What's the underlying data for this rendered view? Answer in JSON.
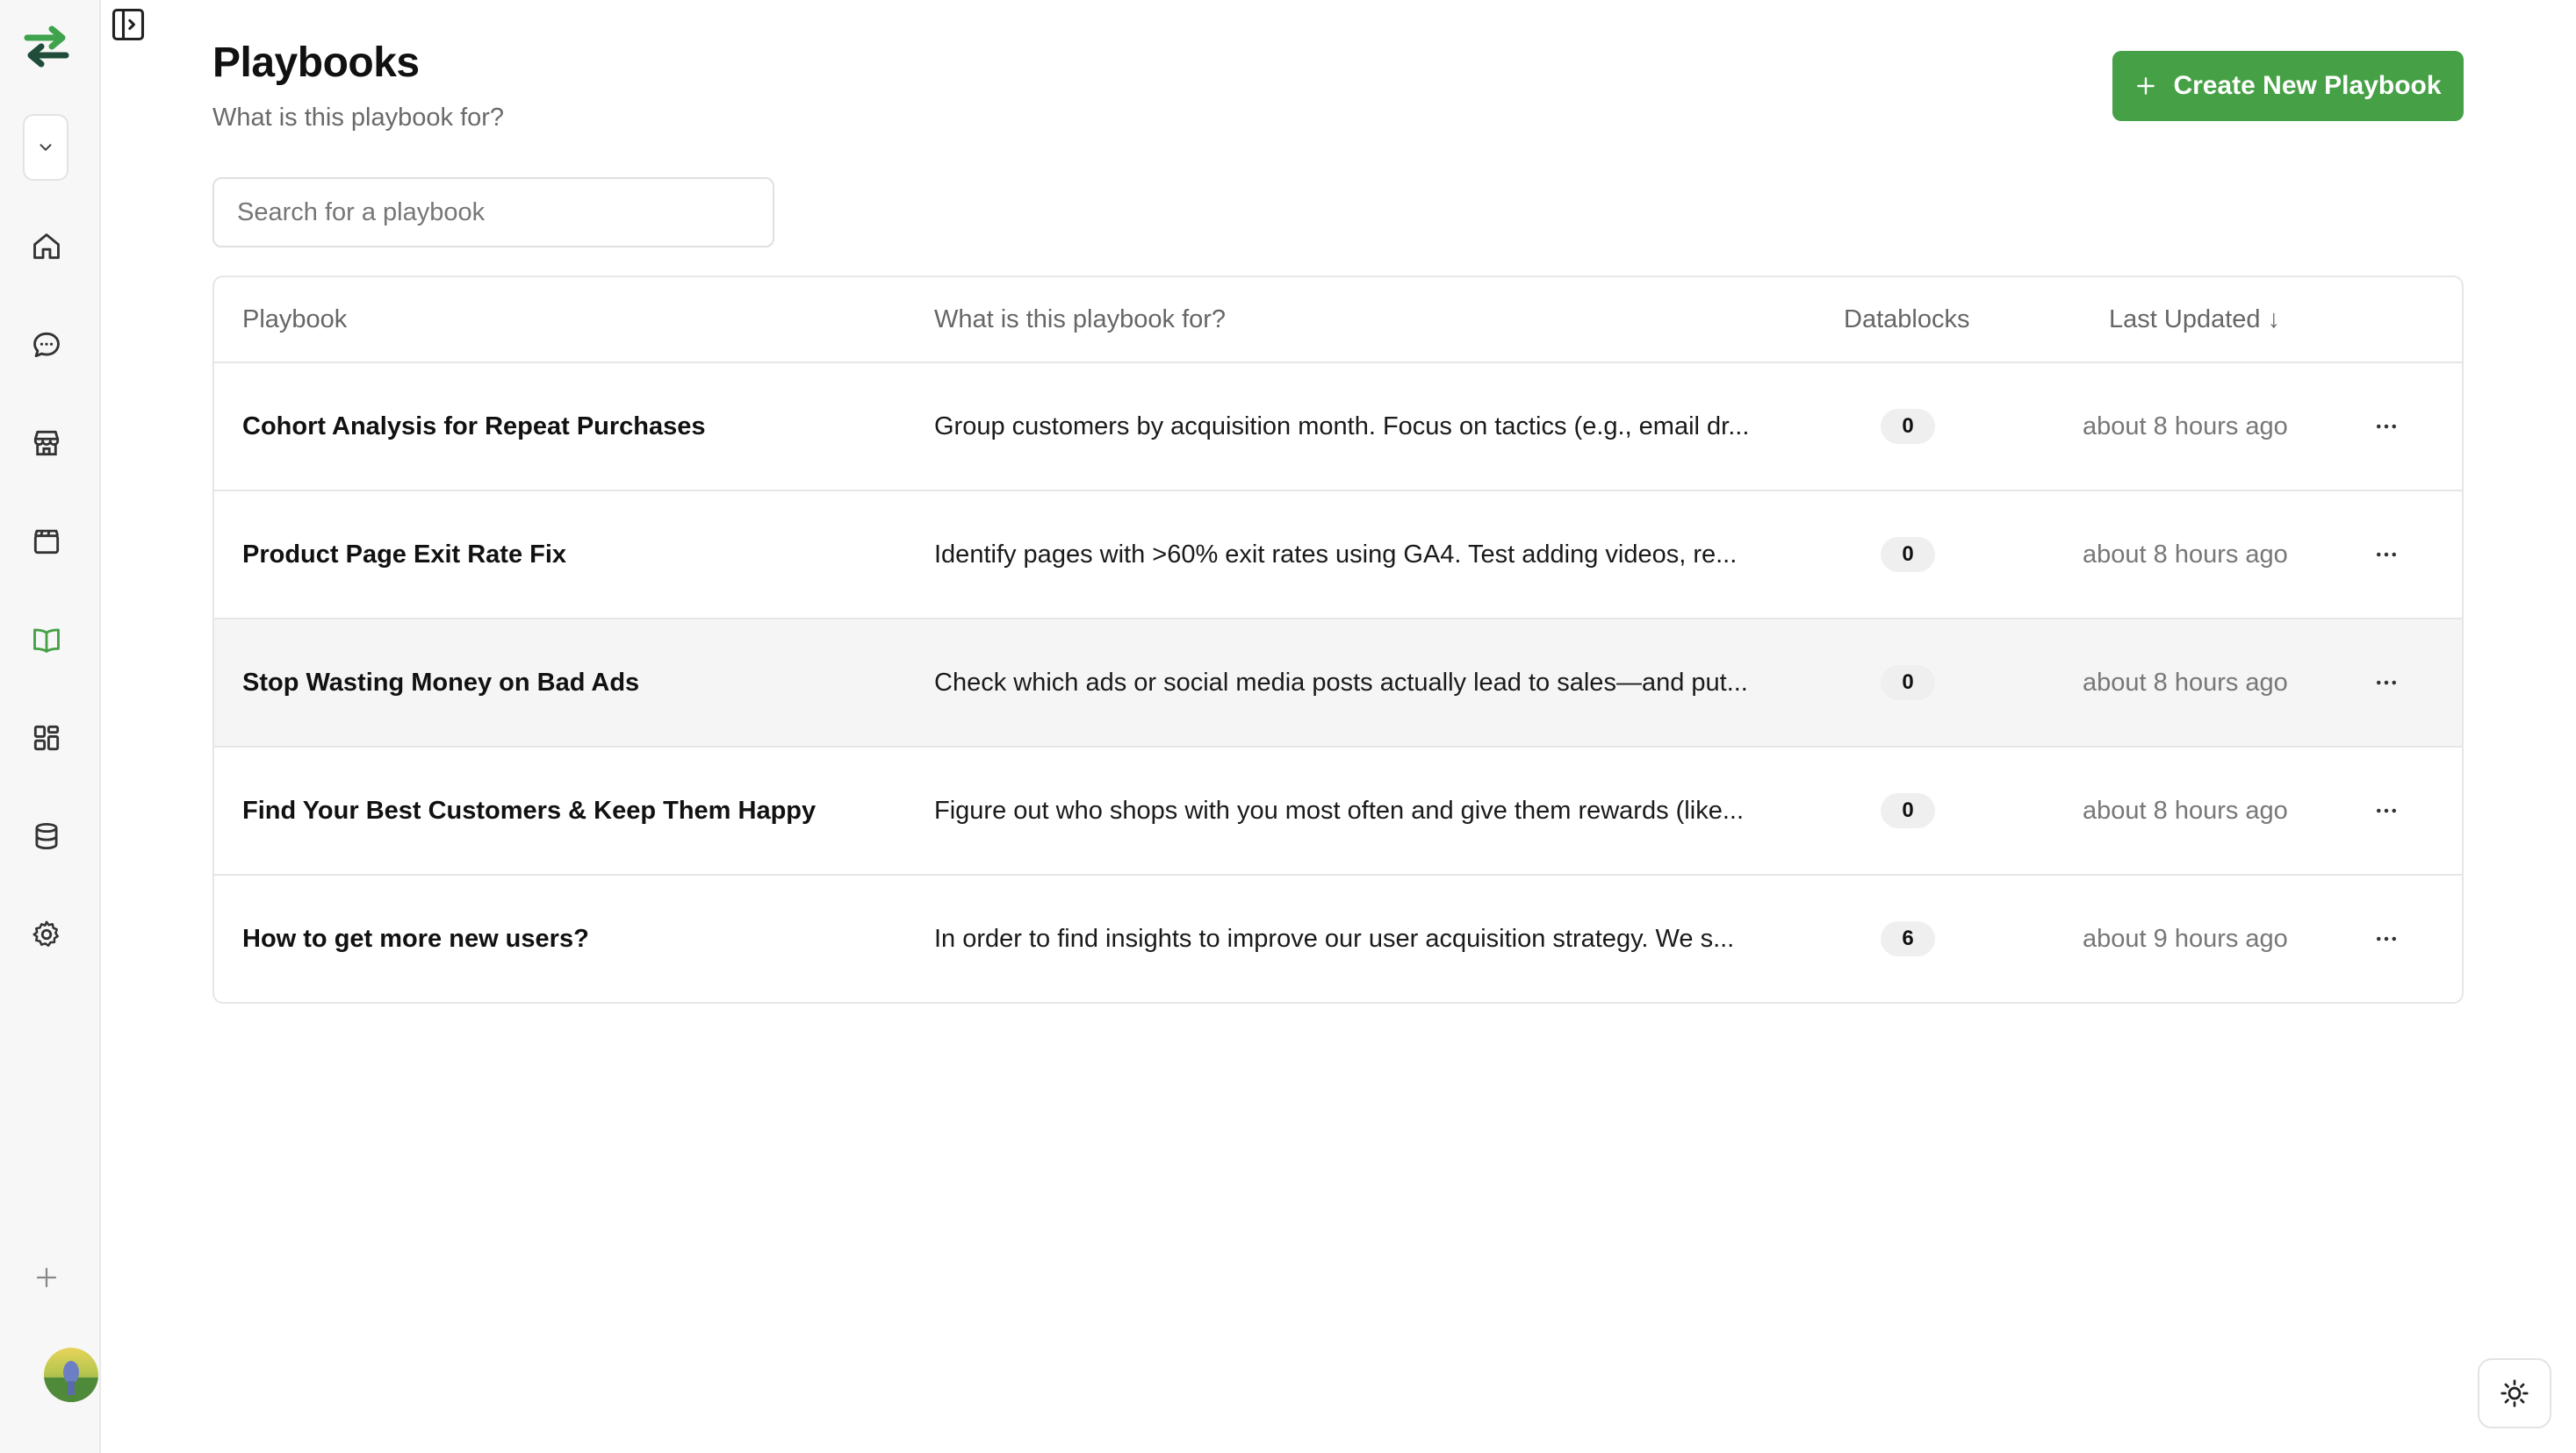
{
  "sidebar": {
    "icons": [
      "logo-icon",
      "chevron-down-icon",
      "home-icon",
      "chat-icon",
      "store-icon",
      "clapperboard-icon",
      "book-open-icon",
      "dashboard-icon",
      "database-icon",
      "gear-icon",
      "plus-icon"
    ],
    "active_item": "playbooks"
  },
  "header": {
    "title": "Playbooks",
    "subtitle": "What is this playbook for?",
    "create_button": "Create New Playbook"
  },
  "search": {
    "placeholder": "Search for a playbook",
    "value": ""
  },
  "table": {
    "columns": {
      "playbook": "Playbook",
      "purpose": "What is this playbook for?",
      "datablocks": "Datablocks",
      "last_updated": "Last Updated ↓"
    },
    "rows": [
      {
        "name": "Cohort Analysis for Repeat Purchases",
        "description": "Group customers by acquisition month. Focus on tactics (e.g., email dr...",
        "datablocks": "0",
        "updated": "about 8 hours ago"
      },
      {
        "name": "Product Page Exit Rate Fix",
        "description": "Identify pages with >60% exit rates using GA4. Test adding videos, re...",
        "datablocks": "0",
        "updated": "about 8 hours ago"
      },
      {
        "name": "Stop Wasting Money on Bad Ads",
        "description": "Check which ads or social media posts actually lead to sales—and put...",
        "datablocks": "0",
        "updated": "about 8 hours ago"
      },
      {
        "name": "Find Your Best Customers & Keep Them Happy",
        "description": "Figure out who shops with you most often and give them rewards (like...",
        "datablocks": "0",
        "updated": "about 8 hours ago"
      },
      {
        "name": "How to get more new users?",
        "description": "In order to find insights to improve our user acquisition strategy. We s...",
        "datablocks": "6",
        "updated": "about 9 hours ago"
      }
    ]
  },
  "colors": {
    "accent": "#46a046",
    "logo_dark": "#1f4d3a",
    "logo_light": "#3fa34d"
  }
}
